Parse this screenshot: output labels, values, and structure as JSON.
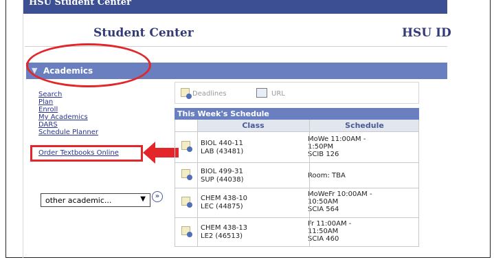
{
  "header": {
    "window_title": "HSU Student Center",
    "page_title": "Student Center",
    "id_label": "HSU ID"
  },
  "academics": {
    "title": "Academics",
    "links": [
      "Search",
      "Plan",
      "Enroll",
      "My Academics",
      "DARS",
      "Schedule Planner"
    ],
    "order_link": "Order Textbooks Online",
    "dropdown_value": "other academic...",
    "go_glyph": "»"
  },
  "quick_links": {
    "deadlines": "Deadlines",
    "url": "URL"
  },
  "schedule": {
    "title": "This Week's Schedule",
    "col_class": "Class",
    "col_schedule": "Schedule",
    "rows": [
      {
        "class_line1": "BIOL 440-11",
        "class_line2": "LAB (43481)",
        "sched1": "MoWe 11:00AM -",
        "sched2": "1:50PM",
        "sched3": "SCIB 126"
      },
      {
        "class_line1": "BIOL 499-31",
        "class_line2": "SUP (44038)",
        "sched1": "Room:  TBA",
        "sched2": "",
        "sched3": ""
      },
      {
        "class_line1": "CHEM 438-10",
        "class_line2": "LEC (44875)",
        "sched1": "MoWeFr 10:00AM -",
        "sched2": "10:50AM",
        "sched3": "SCIA 564"
      },
      {
        "class_line1": "CHEM 438-13",
        "class_line2": "LE2 (46513)",
        "sched1": "Fr 11:00AM -",
        "sched2": "11:50AM",
        "sched3": "SCIA 460"
      }
    ]
  },
  "colors": {
    "header_blue": "#3c4f92",
    "section_blue": "#6a7fc0",
    "highlight_red": "#e2262a",
    "link_blue": "#27328f"
  }
}
